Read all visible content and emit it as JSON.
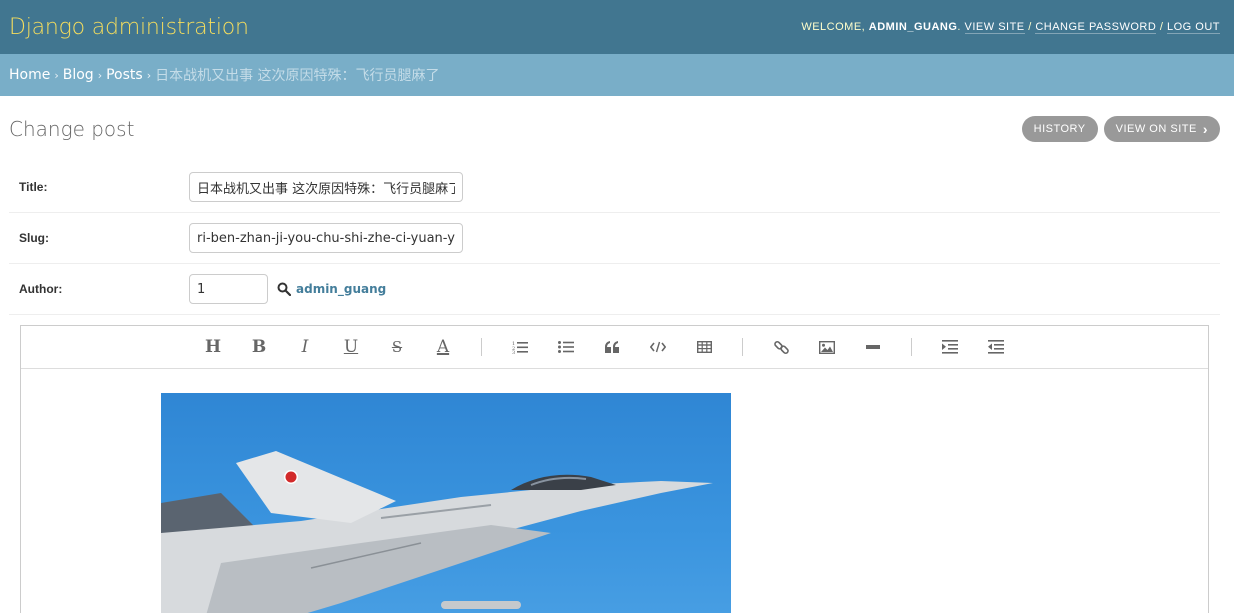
{
  "header": {
    "site_name": "Django administration",
    "welcome": "Welcome,",
    "username": "admin_guang",
    "view_site": "View site",
    "change_password": "Change password",
    "log_out": "Log out"
  },
  "breadcrumbs": {
    "home": "Home",
    "app": "Blog",
    "model": "Posts",
    "current": "日本战机又出事 这次原因特殊：飞行员腿麻了",
    "separator": "›"
  },
  "page": {
    "title": "Change post",
    "history": "History",
    "view_on_site": "View on site"
  },
  "form": {
    "title_label": "Title:",
    "title_value": "日本战机又出事 这次原因特殊：飞行员腿麻了",
    "slug_label": "Slug:",
    "slug_value": "ri-ben-zhan-ji-you-chu-shi-zhe-ci-yuan-yin-te-shu-fei-xing-yuan-tui-ma-liao",
    "author_label": "Author:",
    "author_value": "1",
    "author_name": "admin_guang"
  },
  "toolbar": {
    "heading": "H",
    "bold": "B",
    "italic": "I",
    "underline": "U",
    "strike": "S",
    "font_color": "A"
  },
  "colors": {
    "header_bg": "#417690",
    "site_name": "#f5dd5d",
    "breadcrumbs_bg": "#79aec8",
    "button_bg": "#999999",
    "link": "#447e9b"
  }
}
